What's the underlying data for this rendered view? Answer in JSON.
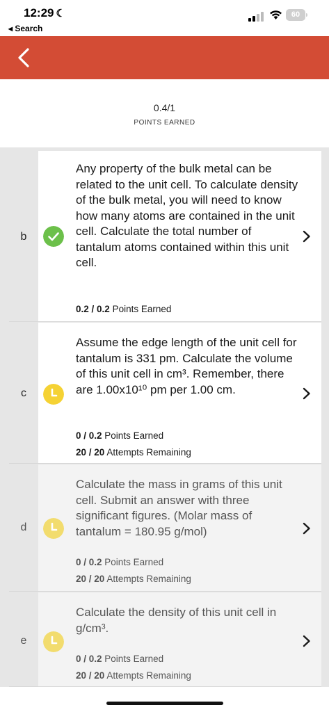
{
  "status": {
    "time": "12:29",
    "back_app": "◂ Search",
    "battery": "60"
  },
  "score": {
    "value": "0.4/1",
    "label": "POINTS EARNED"
  },
  "rows": [
    {
      "letter": "b",
      "status": "correct",
      "text": "Any property of the bulk metal can be related to the unit cell. To calculate density of the bulk metal, you will need to know how many atoms are contained in the unit cell. Calculate the total number of tantalum atoms contained within this unit cell.",
      "points_value": "0.2 / 0.2",
      "points_suffix": "Points Earned"
    },
    {
      "letter": "c",
      "status": "pending",
      "text": "Assume the edge length of the unit cell for tantalum is 331 pm. Calculate the volume of this unit cell in cm³. Remember, there are 1.00x10¹⁰ pm per 1.00 cm.",
      "points_value": "0 / 0.2",
      "points_suffix": "Points Earned",
      "attempts_value": "20 / 20",
      "attempts_suffix": "Attempts Remaining"
    },
    {
      "letter": "d",
      "status": "pending",
      "text": "Calculate the mass in grams of this unit cell. Submit an answer with three significant figures. (Molar mass of tantalum = 180.95 g/mol)",
      "points_value": "0 / 0.2",
      "points_suffix": "Points Earned",
      "attempts_value": "20 / 20",
      "attempts_suffix": "Attempts Remaining"
    },
    {
      "letter": "e",
      "status": "pending",
      "text": "Calculate the density of this unit cell in g/cm³.",
      "points_value": "0 / 0.2",
      "points_suffix": "Points Earned",
      "attempts_value": "20 / 20",
      "attempts_suffix": "Attempts Remaining"
    }
  ],
  "icons": {
    "back": "chevron-left-icon",
    "correct": "check-circle-icon",
    "pending": "clock-icon",
    "open": "chevron-right-icon"
  },
  "colors": {
    "nav": "#d34c35",
    "correct": "#6cc04a",
    "pending_active": "#f5d234",
    "pending_muted": "#f2dc6e"
  }
}
